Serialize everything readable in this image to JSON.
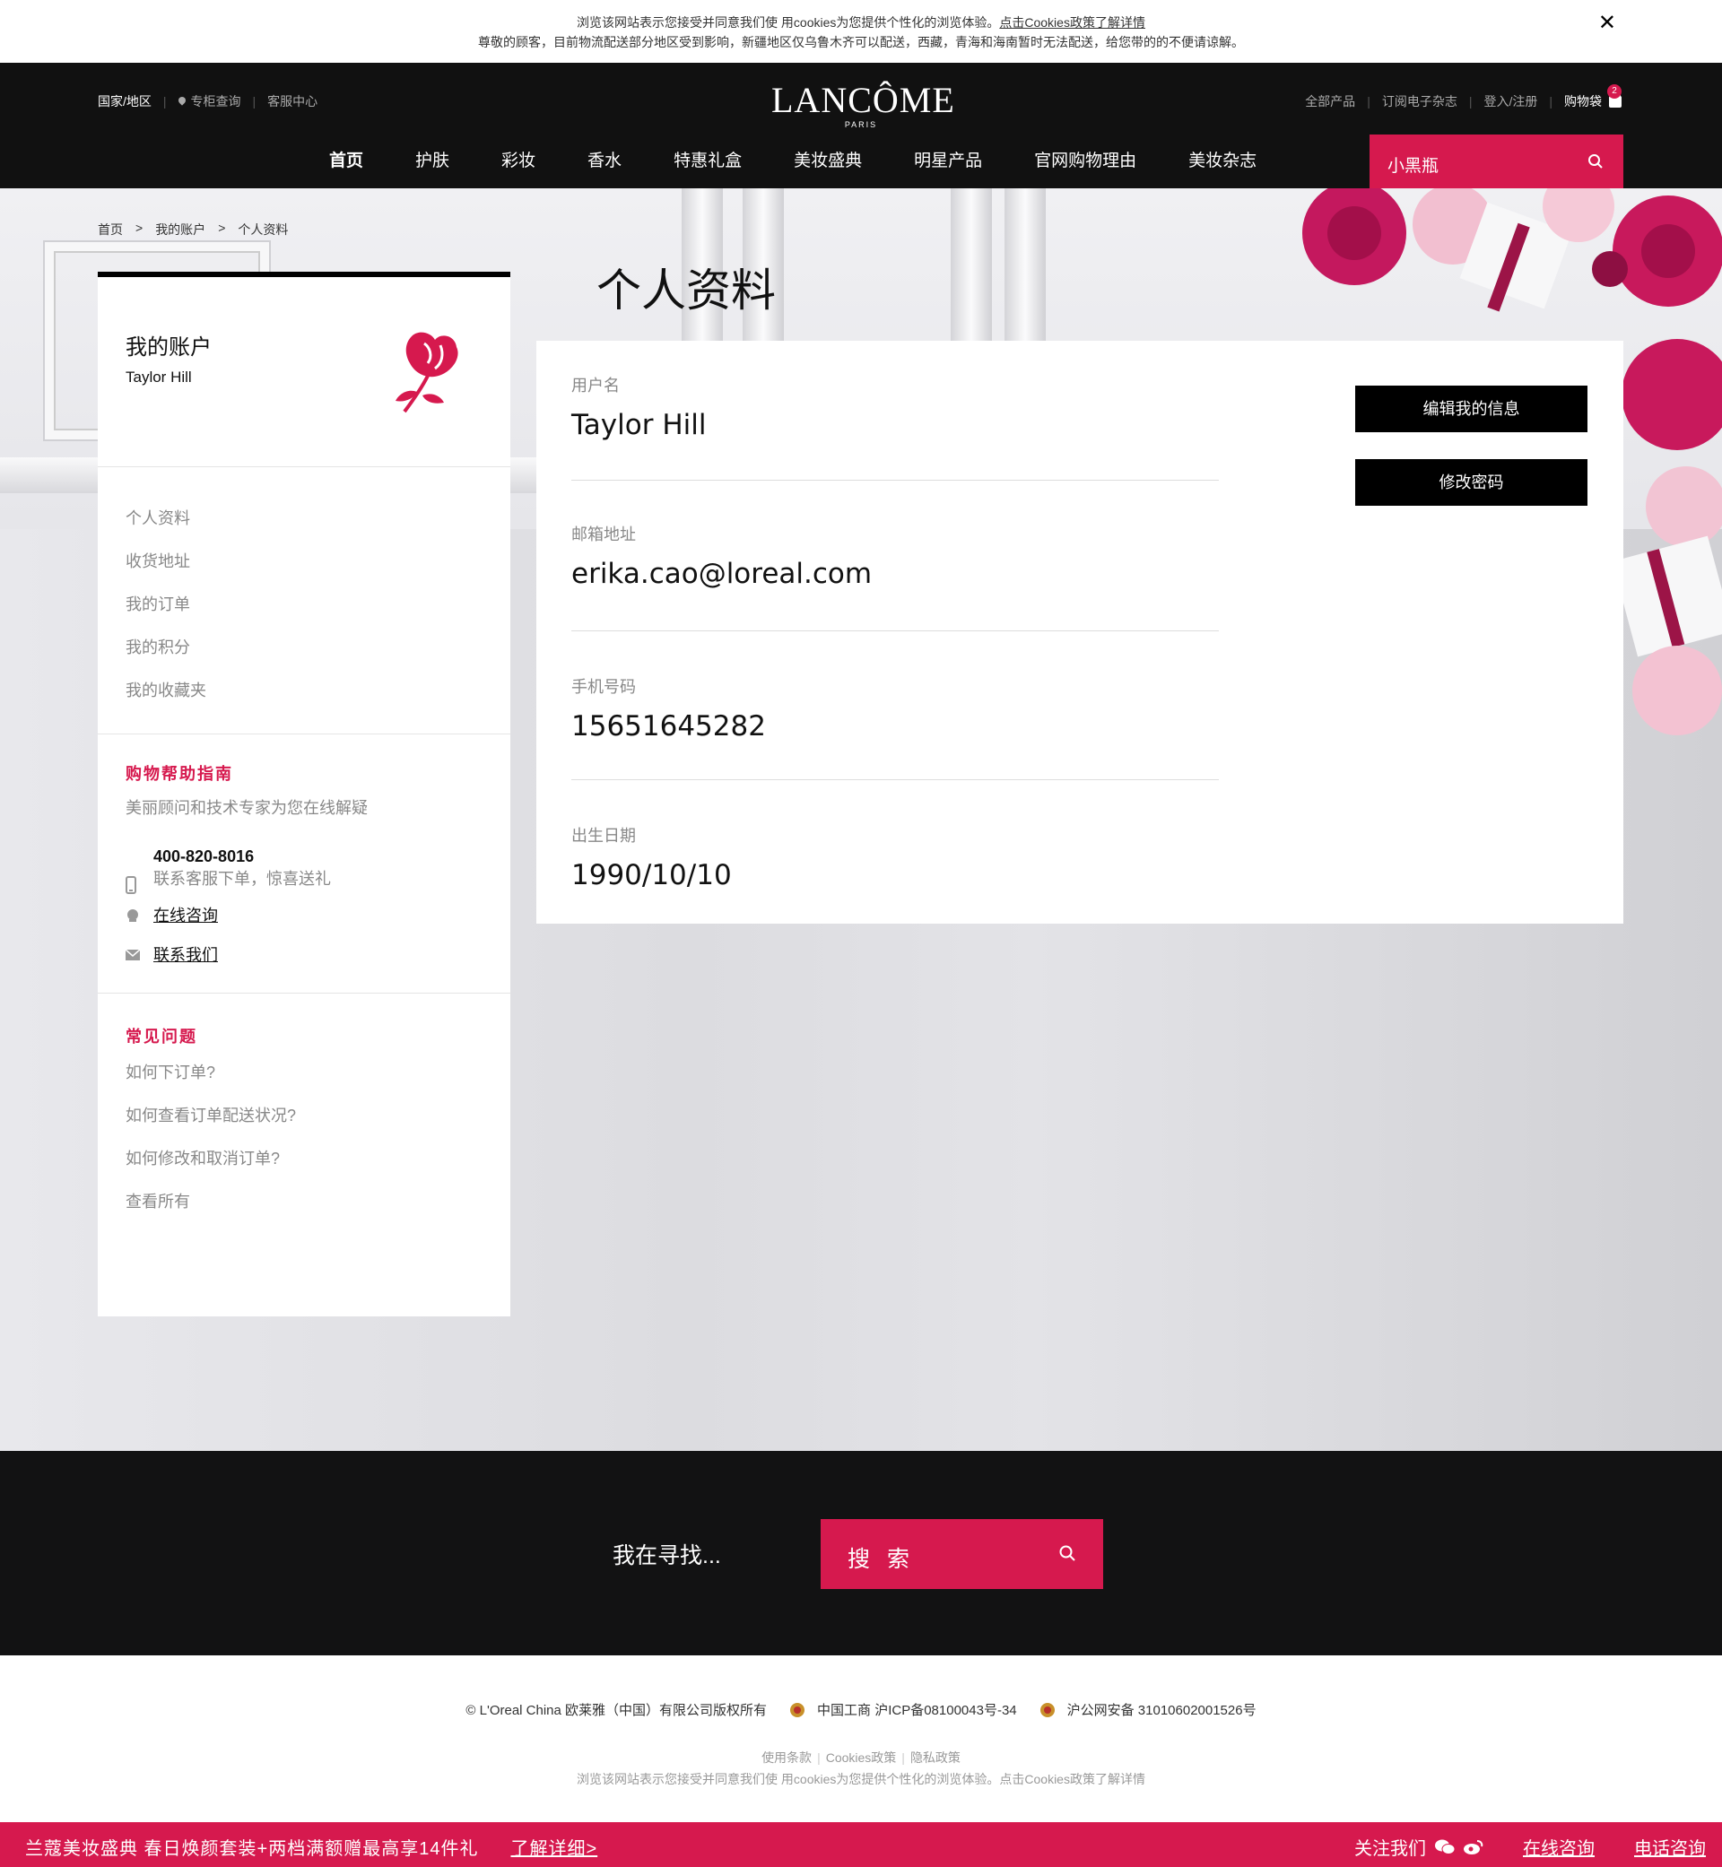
{
  "cookie_bar": {
    "line1_prefix": "浏览该网站表示您接受并同意我们使 用cookies为您提供个性化的浏览体验。",
    "line1_link": "点击Cookies政策了解详情",
    "line2": "尊敬的顾客，目前物流配送部分地区受到影响，新疆地区仅乌鲁木齐可以配送，西藏，青海和海南暂时无法配送，给您带的的不便请谅解。"
  },
  "header": {
    "util_left": [
      "国家/地区",
      "专柜查询",
      "客服中心"
    ],
    "logo": "LANCÔME",
    "logo_sub": "PARIS",
    "util_right": [
      "全部产品",
      "订阅电子杂志",
      "登入/注册",
      "购物袋"
    ],
    "bag_count": "2",
    "nav": [
      "首页",
      "护肤",
      "彩妆",
      "香水",
      "特惠礼盒",
      "美妆盛典",
      "明星产品",
      "官网购物理由",
      "美妆杂志"
    ],
    "search_text": "小黑瓶"
  },
  "breadcrumb": [
    "首页",
    ">",
    "我的账户",
    ">",
    "个人资料"
  ],
  "sidebar": {
    "title": "我的账户",
    "user": "Taylor Hill",
    "menu": [
      "个人资料",
      "收货地址",
      "我的订单",
      "我的积分",
      "我的收藏夹"
    ],
    "help_title": "购物帮助指南",
    "help_desc": "美丽顾问和技术专家为您在线解疑",
    "phone": "400-820-8016",
    "phone_sub": "联系客服下单，惊喜送礼",
    "online": "在线咨询",
    "contact": "联系我们",
    "faq_title": "常见问题",
    "faq": [
      "如何下订单?",
      "如何查看订单配送状况?",
      "如何修改和取消订单?",
      "查看所有"
    ]
  },
  "profile": {
    "page_title": "个人资料",
    "fields": [
      {
        "label": "用户名",
        "value": "Taylor Hill"
      },
      {
        "label": "邮箱地址",
        "value": "erika.cao@loreal.com"
      },
      {
        "label": "手机号码",
        "value": "15651645282"
      },
      {
        "label": "出生日期",
        "value": "1990/10/10"
      }
    ],
    "edit_button": "编辑我的信息",
    "password_button": "修改密码"
  },
  "footer": {
    "search_label": "我在寻找...",
    "search_button": "搜 索",
    "copyright": "© L'Oreal China 欧莱雅（中国）有限公司版权所有",
    "icp": "中国工商 沪ICP备08100043号-34",
    "security": "沪公网安备 31010602001526号",
    "links": [
      "使用条款",
      "Cookies政策",
      "隐私政策"
    ],
    "cookie_note": "浏览该网站表示您接受并同意我们使 用cookies为您提供个性化的浏览体验。点击Cookies政策了解详情"
  },
  "promo": {
    "text": "兰蔻美妆盛典 春日焕颜套装+两档满额赠最高享14件礼",
    "link": "了解详细>",
    "follow": "关注我们",
    "online": "在线咨询",
    "phone": "电话咨询"
  },
  "colors": {
    "accent": "#d6194e",
    "dark": "#111111"
  }
}
